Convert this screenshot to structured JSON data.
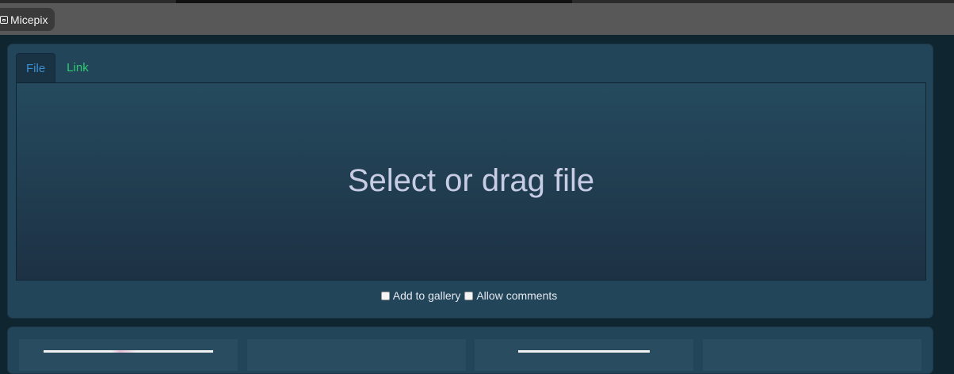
{
  "app": {
    "name": "Micepix"
  },
  "upload": {
    "tabs": [
      {
        "label": "File",
        "active": true
      },
      {
        "label": "Link",
        "active": false
      }
    ],
    "dropzone_text": "Select or drag file",
    "options": [
      {
        "label": "Add to gallery",
        "checked": false
      },
      {
        "label": "Allow comments",
        "checked": false
      }
    ]
  },
  "gallery": {
    "thumbnail_count": 4
  },
  "colors": {
    "accent_active_tab": "#3b8ed0",
    "accent_link_tab": "#2ecc71",
    "panel": "#23455a",
    "background": "#0f2630"
  }
}
